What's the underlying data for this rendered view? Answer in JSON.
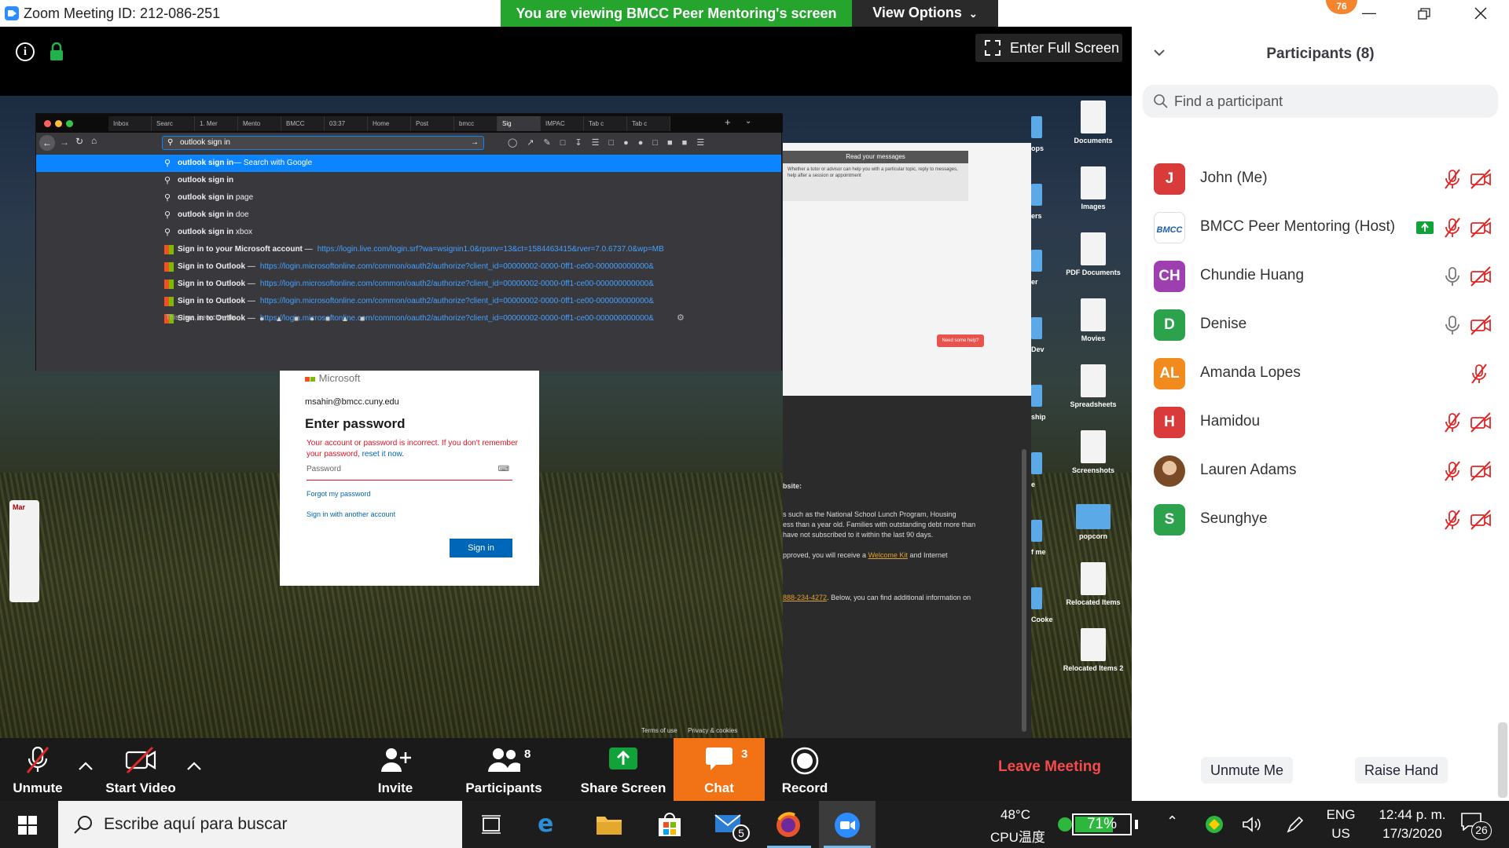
{
  "window": {
    "title": "Zoom Meeting ID: 212-086-251",
    "viewing_banner": "You are viewing BMCC Peer Mentoring's screen",
    "view_options": "View Options",
    "badge_count": "76"
  },
  "meeting": {
    "fullscreen_label": "Enter Full Screen"
  },
  "shared_screen": {
    "browser": {
      "tabs": [
        "Inbox",
        "Searc",
        "1. Mer",
        "Mento",
        "BMCC",
        "03:37",
        "Home",
        "Post",
        "bmcc",
        "Sig",
        "IMPAC",
        "Tab c",
        "Tab c"
      ],
      "url_value": "outlook sign in",
      "suggestions": [
        {
          "bold": "outlook sign in",
          "extra": "— Search with Google",
          "url": ""
        },
        {
          "bold": "outlook sign in",
          "extra": "",
          "url": ""
        },
        {
          "bold": "outlook sign in",
          "extra": " page",
          "url": ""
        },
        {
          "bold": "outlook sign in",
          "extra": " doe",
          "url": ""
        },
        {
          "bold": "outlook sign in",
          "extra": " xbox",
          "url": ""
        },
        {
          "bold": "Sign in to your Microsoft account",
          "extra": " —",
          "url": "https://login.live.com/login.srf?wa=wsignin1.0&rpsnv=13&ct=1584463415&rver=7.0.6737.0&wp=MB"
        },
        {
          "bold": "Sign in to Outlook",
          "extra": " —",
          "url": "https://login.microsoftonline.com/common/oauth2/authorize?client_id=00000002-0000-0ff1-ce00-000000000000&"
        },
        {
          "bold": "Sign in to Outlook",
          "extra": " —",
          "url": "https://login.microsoftonline.com/common/oauth2/authorize?client_id=00000002-0000-0ff1-ce00-000000000000&"
        },
        {
          "bold": "Sign in to Outlook",
          "extra": " —",
          "url": "https://login.microsoftonline.com/common/oauth2/authorize?client_id=00000002-0000-0ff1-ce00-000000000000&"
        },
        {
          "bold": "Sign in to Outlook",
          "extra": " —",
          "url": "https://login.microsoftonline.com/common/oauth2/authorize?client_id=00000002-0000-0ff1-ce00-000000000000&"
        }
      ],
      "search_with": "This time, search with:"
    },
    "signin_card": {
      "logo_text": "Microsoft",
      "email": "msahin@bmcc.cuny.edu",
      "heading": "Enter password",
      "error": "Your account or password is incorrect. If you don't remember your password,",
      "error_link": "reset it now.",
      "password_placeholder": "Password",
      "forgot": "Forgot my password",
      "other_account": "Sign in with another account",
      "signin_button": "Sign in",
      "terms": "Terms of use",
      "privacy": "Privacy & cookies"
    },
    "side_window": {
      "msg_header": "Read your messages",
      "msg_body": "Whether a tutor or advisor can help you with a particular topic, reply to messages, help after a session or appointment",
      "help_btn": "Need some help?",
      "website": "bsite:",
      "lines": [
        "s such as the National School Lunch Program, Housing",
        "ess than a year old. Families with outstanding debt more than",
        "have not subscribed to it within the last 90 days.",
        "pproved, you will receive a"
      ],
      "welcome_kit": "Welcome Kit",
      "and_internet": " and Internet",
      "phone": "888-234-4272",
      "phone_after": ". Below, you can find additional information on"
    },
    "desktop_icons": [
      {
        "label": "Documents",
        "kind": "doc"
      },
      {
        "label": "Images",
        "kind": "doc"
      },
      {
        "label": "PDF Documents",
        "kind": "doc"
      },
      {
        "label": "Movies",
        "kind": "doc"
      },
      {
        "label": "Spreadsheets",
        "kind": "doc"
      },
      {
        "label": "Screenshots",
        "kind": "doc"
      },
      {
        "label": "popcorn",
        "kind": "folder"
      },
      {
        "label": "Relocated Items",
        "kind": "doc"
      },
      {
        "label": "Relocated Items 2",
        "kind": "doc"
      }
    ],
    "left_labels": [
      "ops",
      "ers",
      "er",
      "Dev",
      "ship",
      "e",
      "f me",
      "Cooke"
    ],
    "calendar_month": "Mar"
  },
  "participants": {
    "title": "Participants (8)",
    "search_placeholder": "Find a participant",
    "list": [
      {
        "initials": "J",
        "name": "John (Me)",
        "color": "#d93a3a",
        "mic": "muted",
        "video": "off",
        "sharing": false
      },
      {
        "initials": "BMCC",
        "name": "BMCC Peer Mentoring (Host)",
        "color": "#ffffff",
        "mic": "muted",
        "video": "off",
        "sharing": true
      },
      {
        "initials": "CH",
        "name": "Chundie Huang",
        "color": "#9e3fb0",
        "mic": "on",
        "video": "off",
        "sharing": false
      },
      {
        "initials": "D",
        "name": "Denise",
        "color": "#2ca24c",
        "mic": "on",
        "video": "off",
        "sharing": false
      },
      {
        "initials": "AL",
        "name": "Amanda Lopes",
        "color": "#f28a1e",
        "mic": "muted",
        "video": "none",
        "sharing": false
      },
      {
        "initials": "H",
        "name": "Hamidou",
        "color": "#d93a3a",
        "mic": "muted",
        "video": "off",
        "sharing": false
      },
      {
        "initials": "",
        "name": "Lauren Adams",
        "color": "#c9a27a",
        "mic": "muted",
        "video": "off",
        "sharing": false
      },
      {
        "initials": "S",
        "name": "Seunghye",
        "color": "#2ca24c",
        "mic": "muted",
        "video": "off",
        "sharing": false
      }
    ],
    "unmute_me": "Unmute Me",
    "raise_hand": "Raise Hand"
  },
  "toolbar": {
    "unmute": "Unmute",
    "start_video": "Start Video",
    "invite": "Invite",
    "participants": "Participants",
    "participants_count": "8",
    "share_screen": "Share Screen",
    "chat": "Chat",
    "chat_count": "3",
    "record": "Record",
    "leave": "Leave Meeting"
  },
  "taskbar": {
    "search_placeholder": "Escribe aquí para buscar",
    "mail_badge": "5",
    "temp": "48°C",
    "cpu": "CPU温度",
    "battery_pct": "71%",
    "battery_level": 0.71,
    "lang": "ENG",
    "region": "US",
    "time": "12:44 p. m.",
    "date": "17/3/2020",
    "notifications": "26"
  },
  "colors": {
    "zoom_blue": "#2d8cff",
    "banner_green": "#25a52e",
    "chat_orange": "#f27316",
    "leave_red": "#f74b4b",
    "muted_red": "#e02828"
  }
}
